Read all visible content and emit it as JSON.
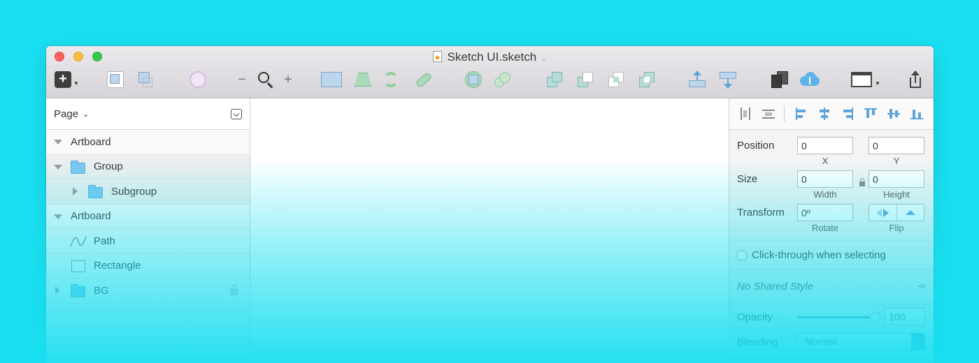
{
  "window": {
    "title": "Sketch UI.sketch"
  },
  "layers": {
    "page_label": "Page",
    "rows": [
      {
        "name": "Artboard"
      },
      {
        "name": "Group"
      },
      {
        "name": "Subgroup"
      },
      {
        "name": "Artboard"
      },
      {
        "name": "Path"
      },
      {
        "name": "Rectangle"
      },
      {
        "name": "BG"
      }
    ]
  },
  "inspector": {
    "position_label": "Position",
    "x_value": "0",
    "y_value": "0",
    "x_label": "X",
    "y_label": "Y",
    "size_label": "Size",
    "width_value": "0",
    "height_value": "0",
    "width_label": "Width",
    "height_label": "Height",
    "transform_label": "Transform",
    "rotate_value": "0º",
    "rotate_label": "Rotate",
    "flip_label": "Flip",
    "click_through_label": "Click-through when selecting",
    "shared_style": "No Shared Style",
    "opacity_label": "Opacity",
    "opacity_value": "100",
    "opacity_fraction": 1.0,
    "blending_label": "Blending",
    "blending_value": "Normal"
  },
  "colors": {
    "background": "#19dff0",
    "accent": "#5fa3d8"
  }
}
